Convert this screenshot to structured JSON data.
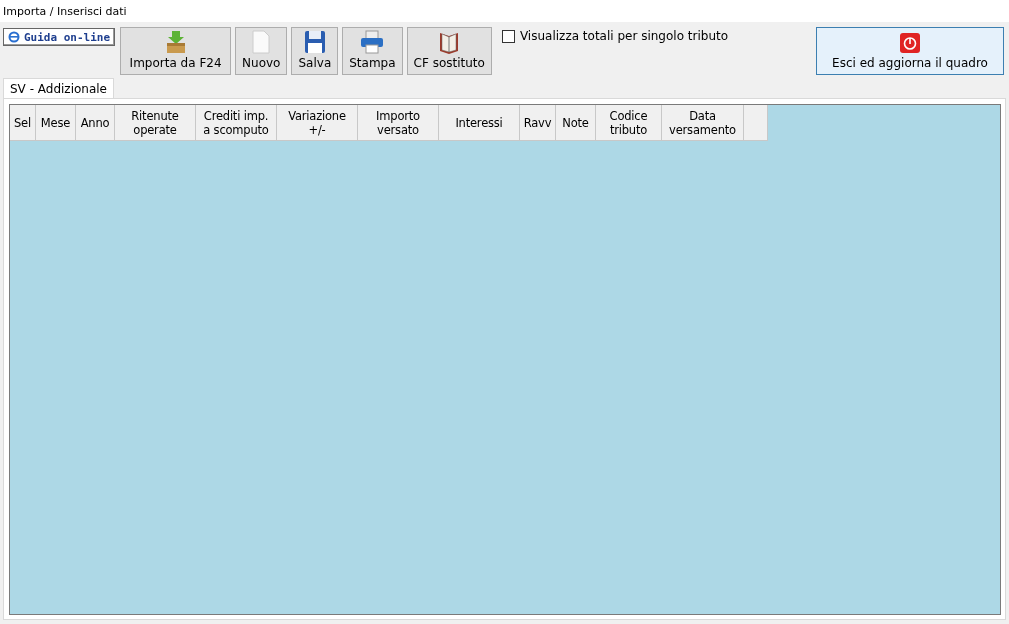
{
  "window": {
    "title": "Importa / Inserisci dati"
  },
  "help_link": {
    "label": "Guida on-line"
  },
  "toolbar": [
    {
      "label": "Importa da F24",
      "kind": "import"
    },
    {
      "label": "Nuovo",
      "kind": "new"
    },
    {
      "label": "Salva",
      "kind": "save"
    },
    {
      "label": "Stampa",
      "kind": "print"
    },
    {
      "label": "CF sostituto",
      "kind": "book"
    }
  ],
  "totals_checkbox": {
    "label": "Visualizza totali per singolo tributo",
    "checked": false
  },
  "exit_button": {
    "label": "Esci ed aggiorna il quadro"
  },
  "tabs": [
    {
      "label": "SV - Addizionale",
      "selected": true
    }
  ],
  "table": {
    "columns": [
      "Sel",
      "Mese",
      "Anno",
      "Ritenute\noperate",
      "Crediti imp.\na scomputo",
      "Variazione\n+/-",
      "Importo\nversato",
      "Interessi",
      "Ravv",
      "Note",
      "Codice\ntributo",
      "Data\nversamento"
    ]
  }
}
